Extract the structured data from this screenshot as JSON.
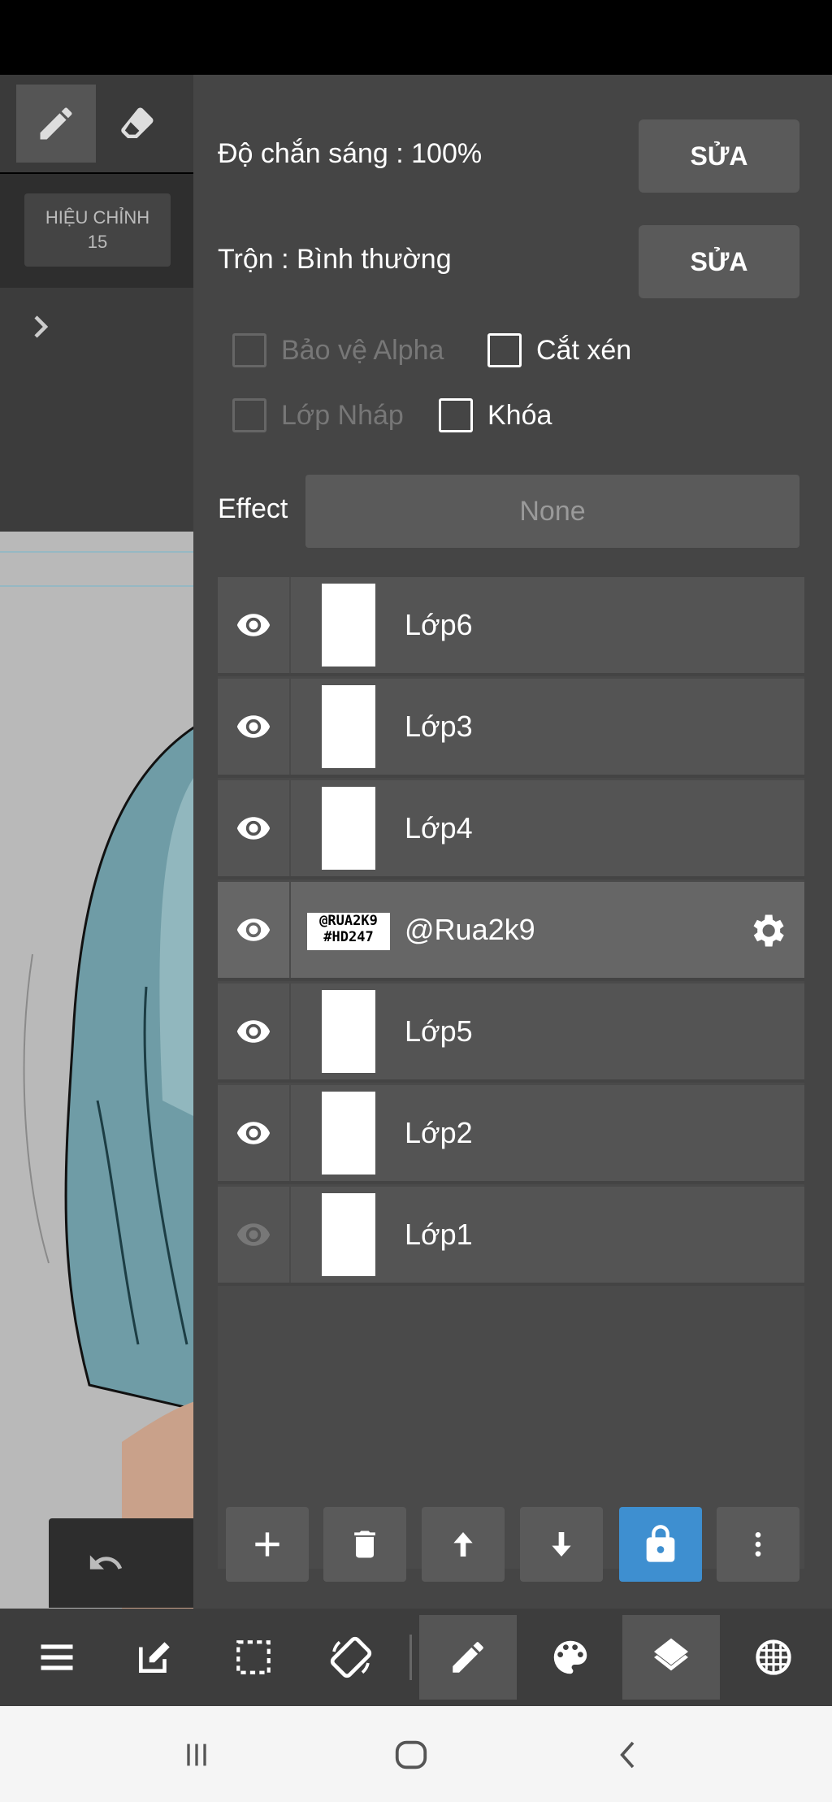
{
  "left_toolbar": {
    "adjust_label": "HIỆU CHỈNH",
    "adjust_value": "15"
  },
  "properties": {
    "opacity_label": "Độ chắn sáng : 100%",
    "blend_label": "Trộn : Bình thường",
    "edit_label": "SỬA",
    "alpha_protect": "Bảo vệ Alpha",
    "clipping": "Cắt xén",
    "draft_layer": "Lớp Nháp",
    "lock": "Khóa",
    "effect_label": "Effect",
    "effect_value": "None"
  },
  "layers": [
    {
      "name": "Lớp6",
      "visible": true
    },
    {
      "name": "Lớp3",
      "visible": true
    },
    {
      "name": "Lớp4",
      "visible": true
    },
    {
      "name": "@Rua2k9",
      "visible": true,
      "selected": true,
      "thumb_text_1": "@RUA2K9",
      "thumb_text_2": "#HD247"
    },
    {
      "name": "Lớp5",
      "visible": true
    },
    {
      "name": "Lớp2",
      "visible": true
    },
    {
      "name": "Lớp1",
      "visible": false
    }
  ],
  "colors": {
    "panel_bg": "#454545",
    "accent": "#3e8fd0",
    "row_bg": "#545454",
    "selected_row": "#666666"
  }
}
